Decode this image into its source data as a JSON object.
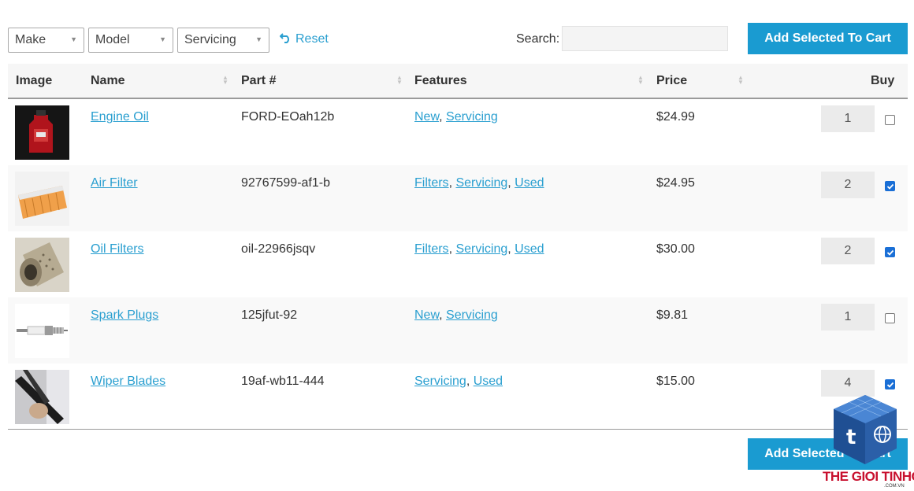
{
  "filters": {
    "make": "Make",
    "model": "Model",
    "servicing": "Servicing",
    "reset": "Reset"
  },
  "search": {
    "label": "Search:",
    "value": ""
  },
  "buttons": {
    "add_top": "Add Selected To Cart",
    "add_bottom": "Add Selected To Cart"
  },
  "table": {
    "headers": {
      "image": "Image",
      "name": "Name",
      "part": "Part #",
      "features": "Features",
      "price": "Price",
      "buy": "Buy"
    },
    "rows": [
      {
        "name": "Engine Oil",
        "part": "FORD-EOah12b",
        "features": [
          "New",
          "Servicing"
        ],
        "price": "$24.99",
        "qty": "1",
        "checked": false
      },
      {
        "name": "Air Filter",
        "part": "92767599-af1-b",
        "features": [
          "Filters",
          "Servicing",
          "Used"
        ],
        "price": "$24.95",
        "qty": "2",
        "checked": true
      },
      {
        "name": "Oil Filters",
        "part": "oil-22966jsqv",
        "features": [
          "Filters",
          "Servicing",
          "Used"
        ],
        "price": "$30.00",
        "qty": "2",
        "checked": true
      },
      {
        "name": "Spark Plugs",
        "part": "125jfut-92",
        "features": [
          "New",
          "Servicing"
        ],
        "price": "$9.81",
        "qty": "1",
        "checked": false
      },
      {
        "name": "Wiper Blades",
        "part": "19af-wb11-444",
        "features": [
          "Servicing",
          "Used"
        ],
        "price": "$15.00",
        "qty": "4",
        "checked": true
      }
    ]
  },
  "watermark": {
    "brand": "THE GIOI TINHOC",
    "domain": ".COM.VN"
  },
  "colors": {
    "accent": "#1a9bd1",
    "link": "#2a9fd0",
    "checkbox": "#1a6fd6"
  }
}
